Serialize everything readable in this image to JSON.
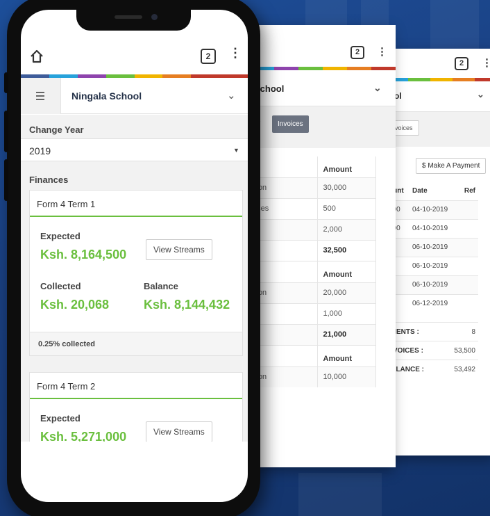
{
  "colors": {
    "accent_green": "#6abf3e",
    "rainbow": [
      "#3e5c9a",
      "#27a2db",
      "#8e44ad",
      "#6abf3e",
      "#f0b400",
      "#e67e22",
      "#c0392b",
      "#c0392b"
    ]
  },
  "phone": {
    "browser": {
      "tab_count": "2"
    },
    "header": {
      "school_name": "Ningala School"
    },
    "change_year_label": "Change Year",
    "year_value": "2019",
    "finances_label": "Finances",
    "terms": [
      {
        "title": "Form 4 Term 1",
        "expected_label": "Expected",
        "expected": "Ksh. 8,164,500",
        "view_streams": "View Streams",
        "collected_label": "Collected",
        "collected": "Ksh. 20,068",
        "balance_label": "Balance",
        "balance": "Ksh. 8,144,432",
        "footer": "0.25% collected"
      },
      {
        "title": "Form 4 Term 2",
        "expected_label": "Expected",
        "expected": "Ksh. 5,271,000",
        "view_streams": "View Streams"
      }
    ]
  },
  "mid": {
    "tab_count": "2",
    "school_name_partial": "School",
    "tab_inactive_partial": "e",
    "tab_active": "Invoices",
    "blocks": [
      {
        "header": "Amount",
        "rows": [
          [
            "ition",
            "30,000"
          ],
          [
            "nses",
            "500"
          ],
          [
            "",
            "2,000"
          ]
        ],
        "total": "32,500"
      },
      {
        "header": "Amount",
        "rows": [
          [
            "ition",
            "20,000"
          ],
          [
            "",
            "1,000"
          ]
        ],
        "total": "21,000"
      },
      {
        "header": "Amount",
        "rows": [
          [
            "ition",
            "10,000"
          ]
        ]
      }
    ]
  },
  "back": {
    "tab_count": "2",
    "school_name_partial": "ol",
    "tab_partial": "voices",
    "make_payment": "$ Make A Payment",
    "columns": [
      "ount",
      "Date",
      "Ref"
    ],
    "rows": [
      [
        "500",
        "04-10-2019",
        ""
      ],
      [
        "000",
        "04-10-2019",
        ""
      ],
      [
        "",
        "06-10-2019",
        ""
      ],
      [
        "",
        "06-10-2019",
        ""
      ],
      [
        "",
        "06-10-2019",
        ""
      ],
      [
        "",
        "06-12-2019",
        ""
      ]
    ],
    "summary": [
      [
        "YMENTS :",
        "8"
      ],
      [
        "INVOICES :",
        "53,500"
      ],
      [
        "BALANCE :",
        "53,492"
      ]
    ]
  }
}
